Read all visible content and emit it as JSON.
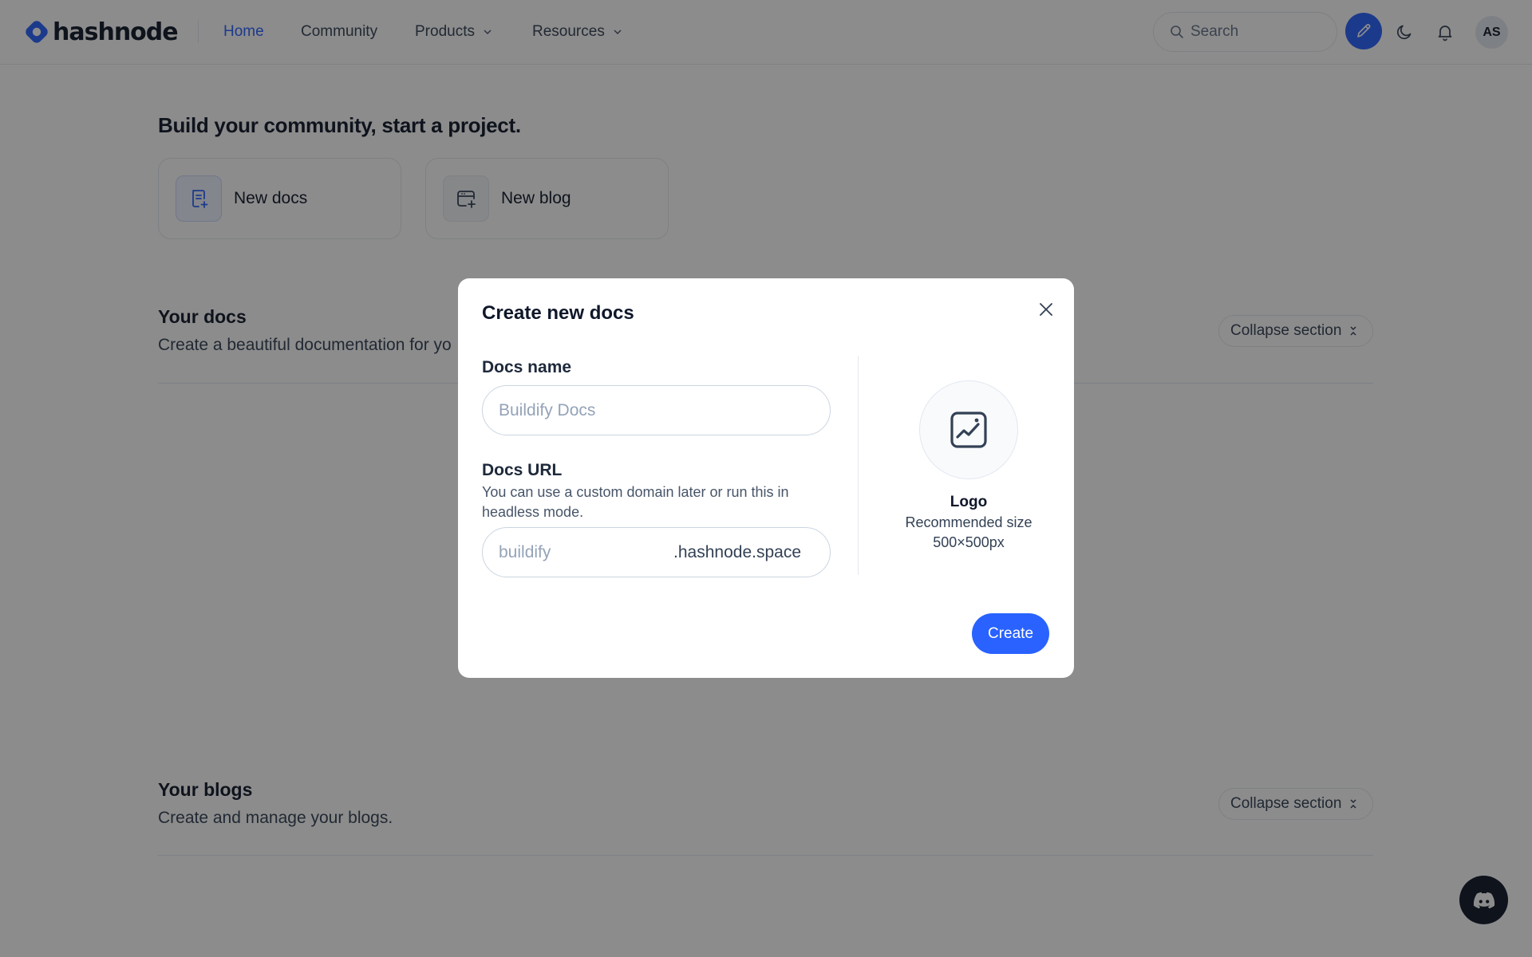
{
  "header": {
    "brand": "hashnode",
    "nav": [
      {
        "label": "Home",
        "active": true
      },
      {
        "label": "Community"
      },
      {
        "label": "Products",
        "dropdown": true
      },
      {
        "label": "Resources",
        "dropdown": true
      }
    ],
    "search_placeholder": "Search",
    "avatar_initials": "AS",
    "accent": "#2962ff"
  },
  "main": {
    "heading": "Build your community, start a project.",
    "cards": [
      {
        "label": "New docs",
        "icon": "docs-plus-icon"
      },
      {
        "label": "New blog",
        "icon": "blog-plus-icon"
      }
    ],
    "sections": [
      {
        "title": "Your docs",
        "description": "Create a beautiful documentation for yo",
        "collapse_label": "Collapse section"
      },
      {
        "title": "Your blogs",
        "description": "Create and manage your blogs.",
        "collapse_label": "Collapse section"
      }
    ]
  },
  "modal": {
    "title": "Create new docs",
    "docs_name_label": "Docs name",
    "docs_name_placeholder": "Buildify Docs",
    "docs_url_label": "Docs URL",
    "docs_url_help": "You can use a custom domain later or run this in headless mode.",
    "docs_url_placeholder": "buildify",
    "docs_url_suffix": ".hashnode.space",
    "logo_label": "Logo",
    "logo_hint_1": "Recommended size",
    "logo_hint_2": "500×500px",
    "create_label": "Create"
  }
}
